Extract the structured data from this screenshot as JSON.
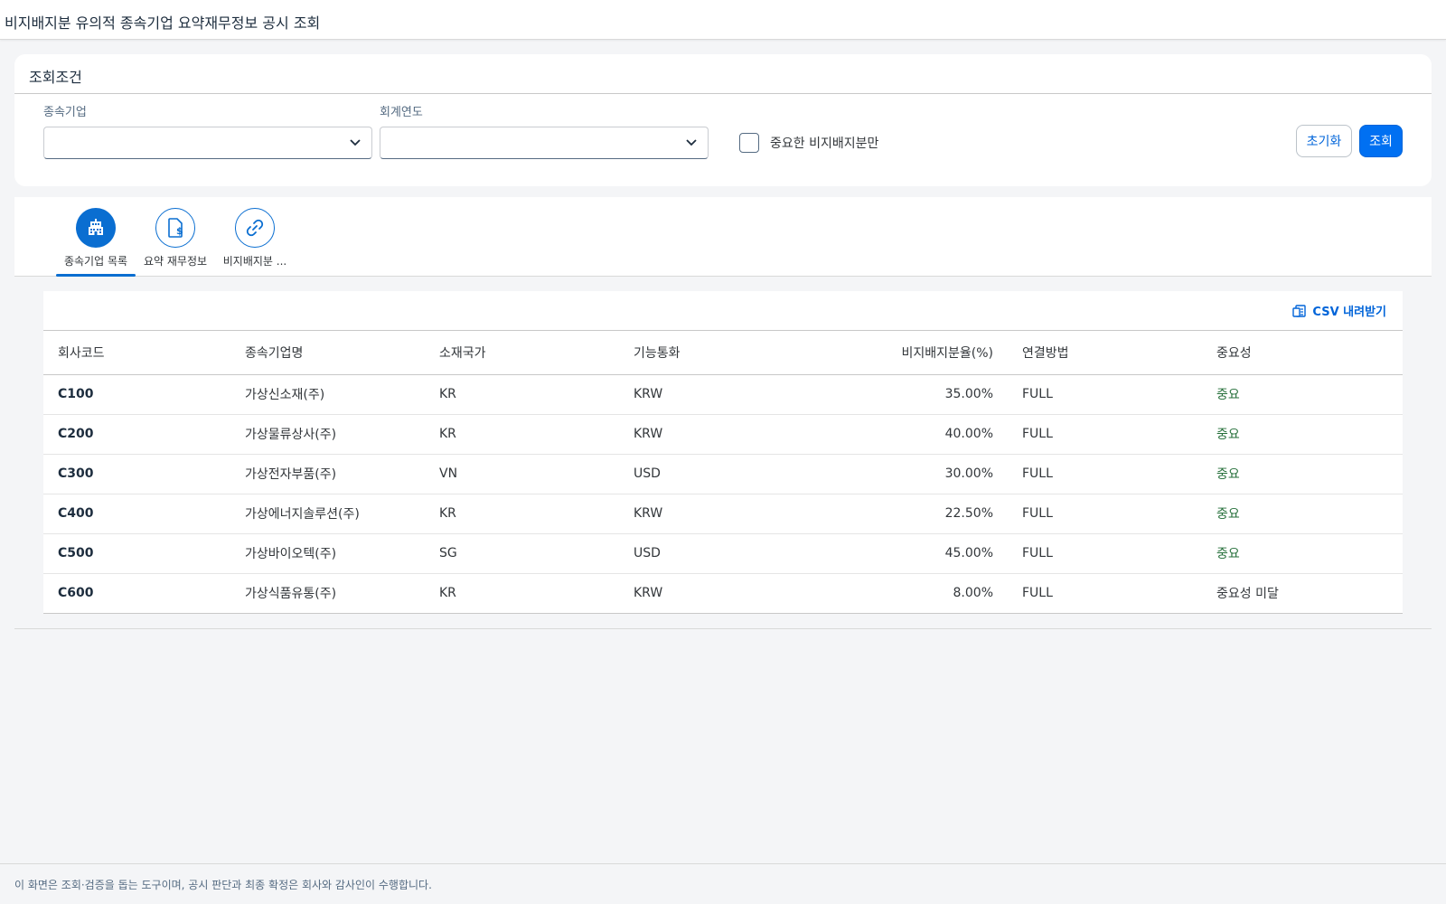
{
  "shell": {
    "title": "비지배지분 유의적 종속기업 요약재무정보 공시 조회"
  },
  "filter": {
    "title": "조회조건",
    "subsidiary_label": "종속기업",
    "subsidiary_value": "",
    "fiscal_year_label": "회계연도",
    "fiscal_year_value": "",
    "checkbox_label": "중요한 비지배지분만",
    "checkbox_checked": false,
    "reset_label": "초기화",
    "search_label": "조회"
  },
  "tabs": [
    {
      "label": "종속기업 목록",
      "icon": "building-icon",
      "active": true
    },
    {
      "label": "요약 재무정보",
      "icon": "finance-document-icon",
      "active": false
    },
    {
      "label": "비지배지분 ...",
      "icon": "link-icon",
      "active": false
    }
  ],
  "table": {
    "csv_label": "CSV 내려받기",
    "headers": [
      "회사코드",
      "종속기업명",
      "소재국가",
      "기능통화",
      "비지배지분율(%)",
      "연결방법",
      "중요성"
    ],
    "rows": [
      [
        "C100",
        "가상신소재(주)",
        "KR",
        "KRW",
        "35.00%",
        "FULL",
        "중요"
      ],
      [
        "C200",
        "가상물류상사(주)",
        "KR",
        "KRW",
        "40.00%",
        "FULL",
        "중요"
      ],
      [
        "C300",
        "가상전자부품(주)",
        "VN",
        "USD",
        "30.00%",
        "FULL",
        "중요"
      ],
      [
        "C400",
        "가상에너지솔루션(주)",
        "KR",
        "KRW",
        "22.50%",
        "FULL",
        "중요"
      ],
      [
        "C500",
        "가상바이오텍(주)",
        "SG",
        "USD",
        "45.00%",
        "FULL",
        "중요"
      ],
      [
        "C600",
        "가상식품유통(주)",
        "KR",
        "KRW",
        "8.00%",
        "FULL",
        "중요성 미달"
      ]
    ]
  },
  "footer": {
    "text": "이 화면은 조회·검증을 돕는 도구이며, 공시 판단과 최종 확정은 회사와 감사인이 수행합니다."
  },
  "colors": {
    "accent": "#0070f2",
    "important": "#256f3a",
    "background": "#f4f5f7"
  }
}
